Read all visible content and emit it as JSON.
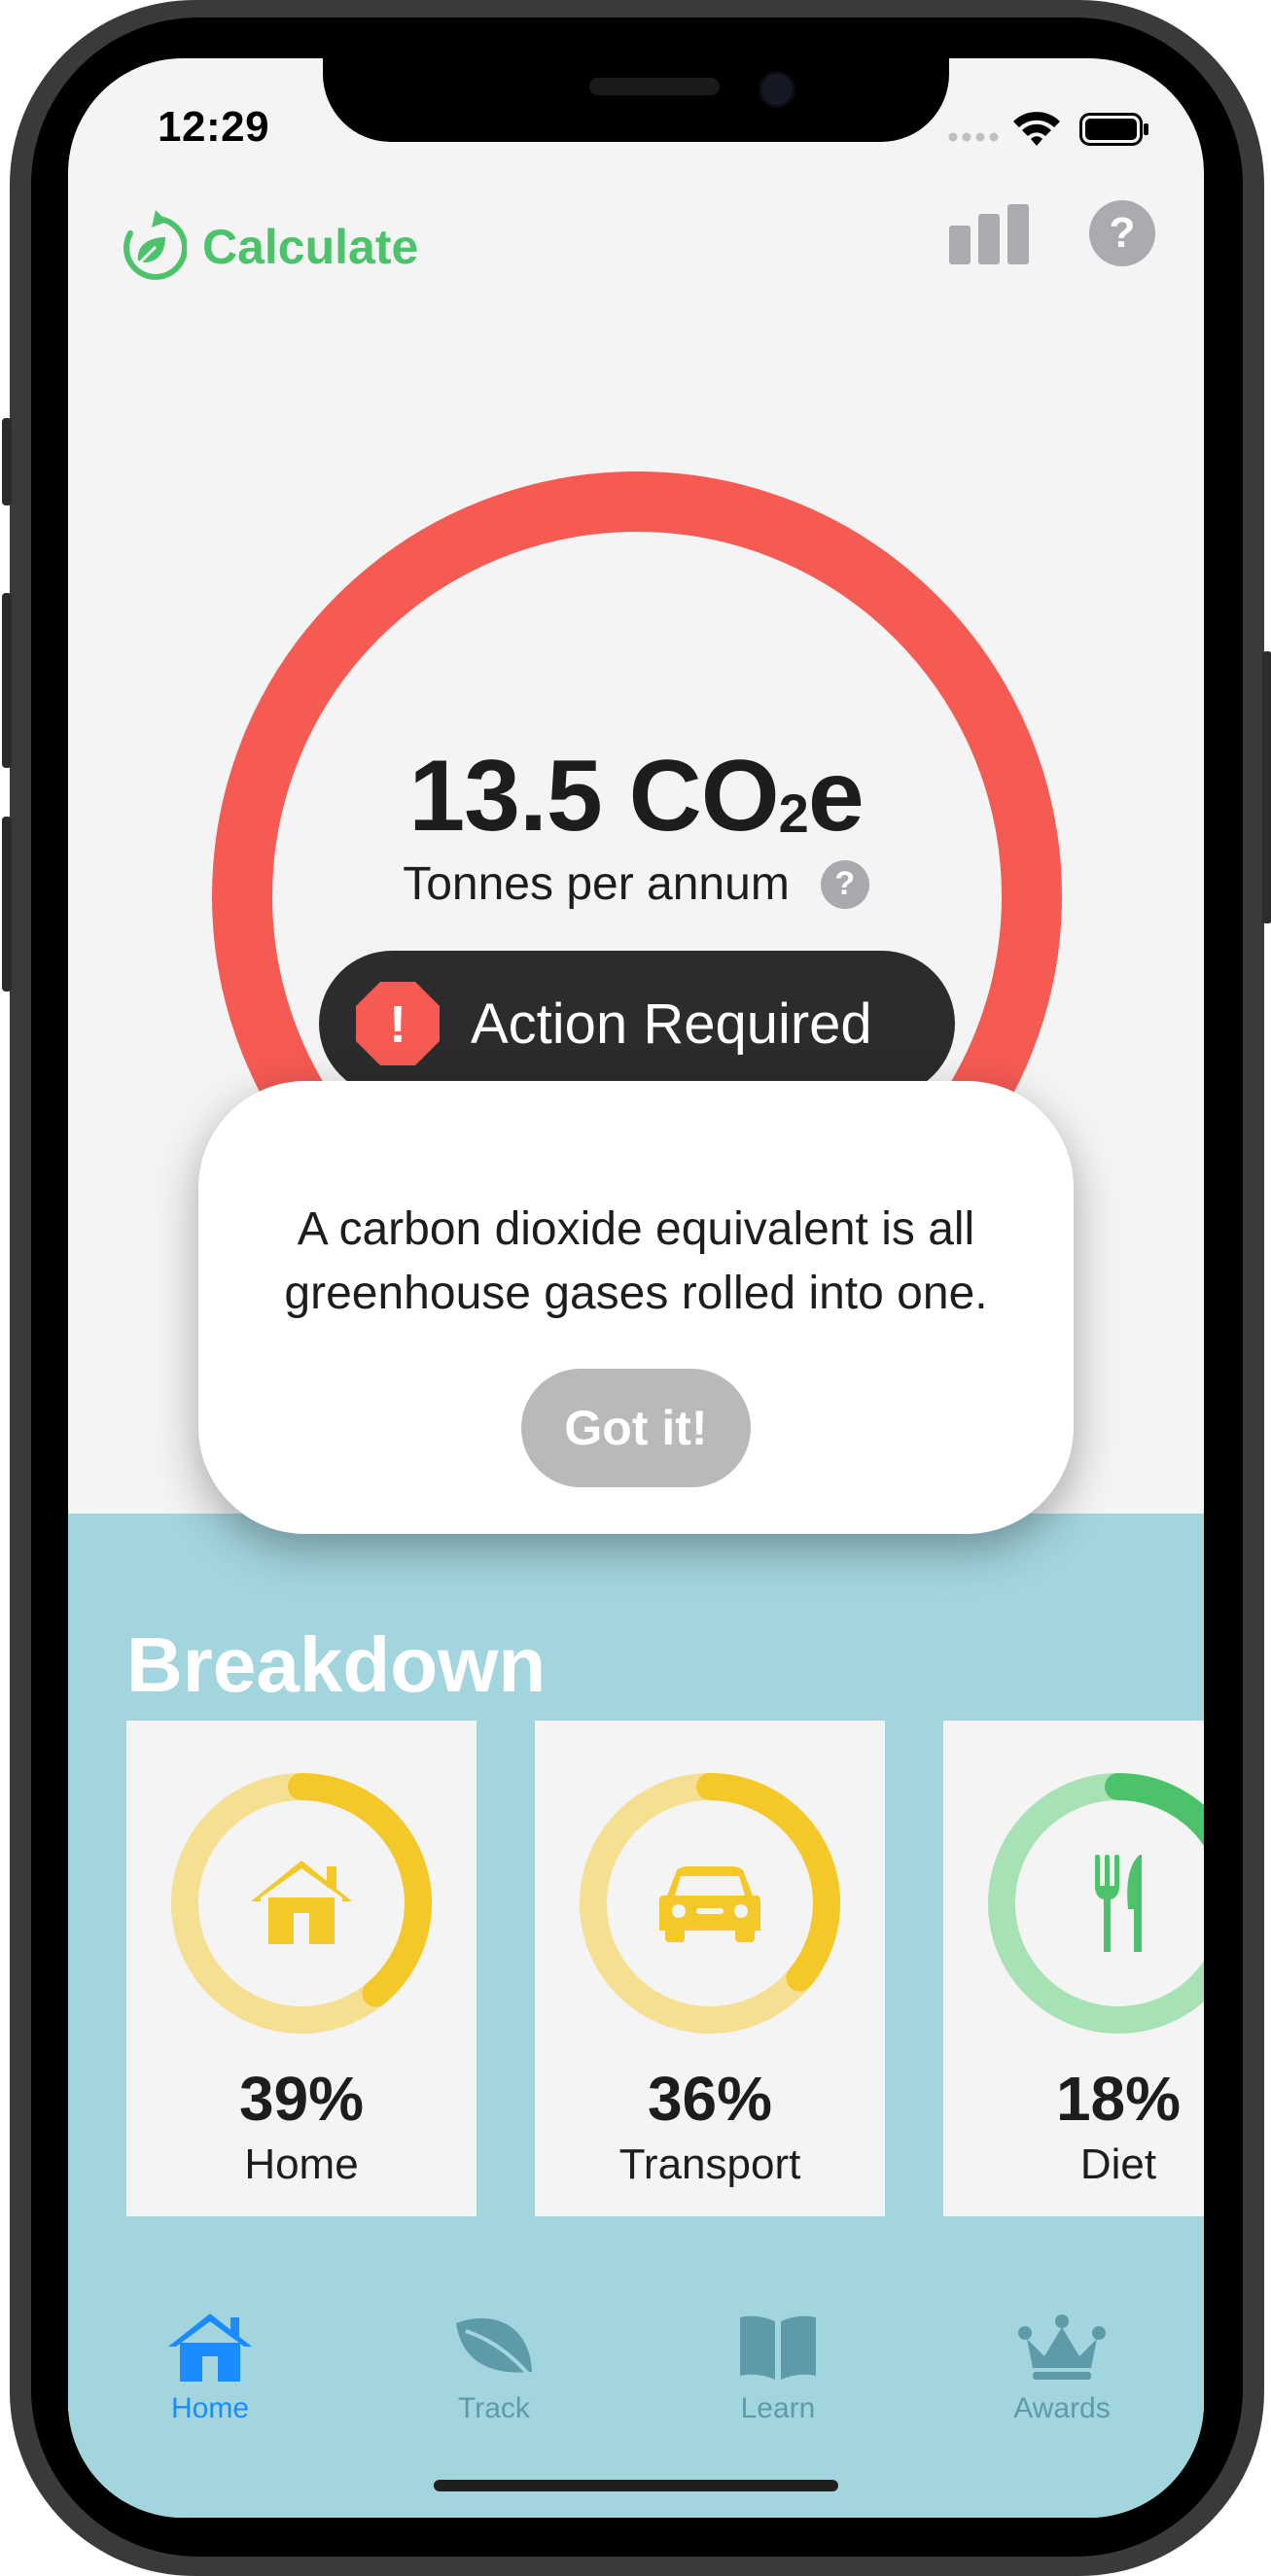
{
  "status_bar": {
    "time": "12:29"
  },
  "topbar": {
    "calculate_label": "Calculate"
  },
  "footprint": {
    "value": "13.5 CO",
    "subscript": "2",
    "suffix": "e",
    "unit_label": "Tonnes per annum",
    "help_mark": "?",
    "action_label": "Action Required",
    "action_icon": "!",
    "ring_color": "#f55a53"
  },
  "tooltip": {
    "text_line1": "A carbon dioxide equivalent is all",
    "text_line2": "greenhouse gases rolled into one.",
    "button_label": "Got it!"
  },
  "breakdown": {
    "title": "Breakdown",
    "cards": [
      {
        "percent_label": "39%",
        "label": "Home",
        "fraction": 0.39,
        "color": "#f5c82a",
        "track": "#f5df90",
        "icon": "house-icon"
      },
      {
        "percent_label": "36%",
        "label": "Transport",
        "fraction": 0.36,
        "color": "#f5c82a",
        "track": "#f5df90",
        "icon": "car-icon"
      },
      {
        "percent_label": "18%",
        "label": "Diet",
        "fraction": 0.18,
        "color": "#4cc36a",
        "track": "#a7e2b4",
        "icon": "fork-knife-icon"
      }
    ]
  },
  "tabs": [
    {
      "label": "Home",
      "icon": "house-icon",
      "active": true
    },
    {
      "label": "Track",
      "icon": "leaf-icon",
      "active": false
    },
    {
      "label": "Learn",
      "icon": "book-icon",
      "active": false
    },
    {
      "label": "Awards",
      "icon": "crown-icon",
      "active": false
    }
  ],
  "colors": {
    "accent_green": "#4cc36a",
    "active_tab": "#1a8cff",
    "inactive_tab": "#5e9ba8",
    "breakdown_bg": "#a3d5de"
  }
}
